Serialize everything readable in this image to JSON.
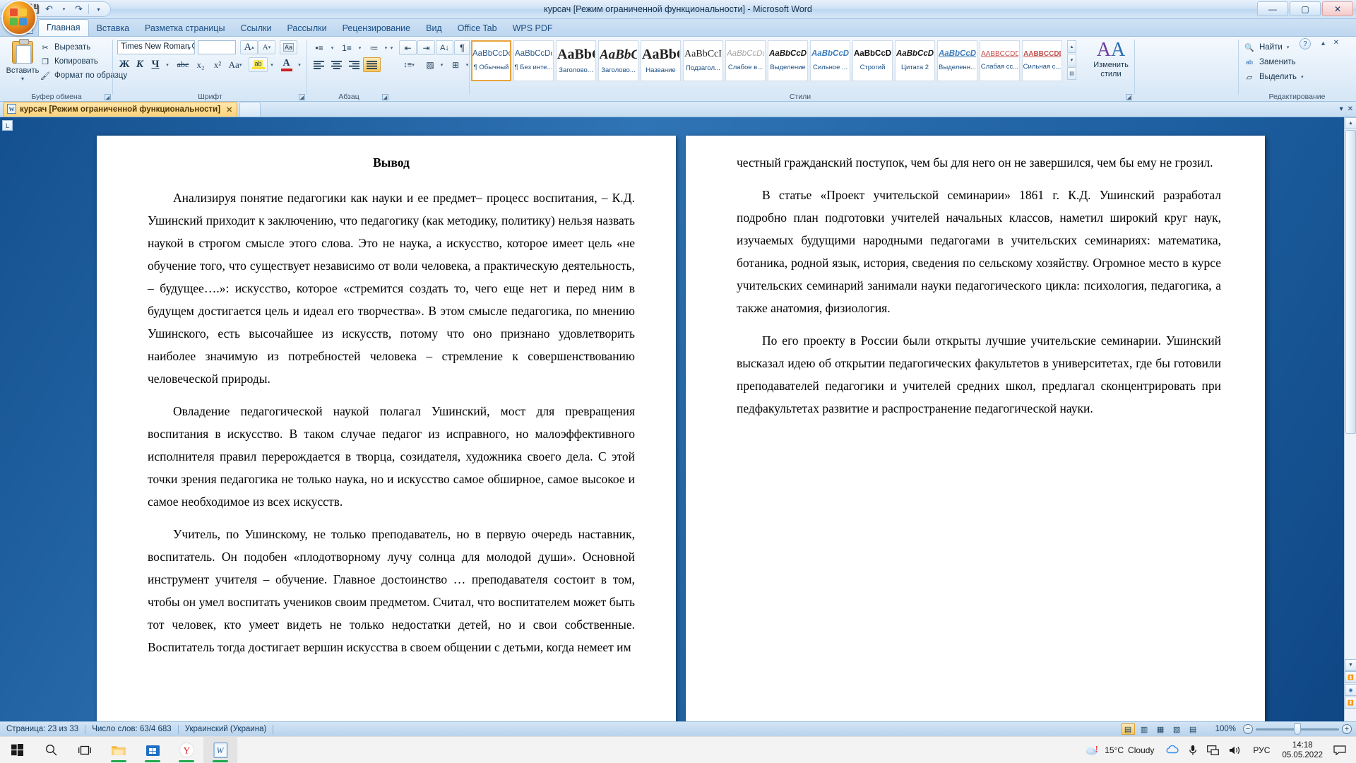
{
  "window": {
    "title": "курсач [Режим ограниченной функциональности] - Microsoft Word",
    "minimize": "—",
    "maximize": "▢",
    "close": "✕"
  },
  "quick_access": {
    "save": "💾",
    "undo": "↶",
    "undo_arrow": "▾",
    "redo": "↷",
    "customize": "▾"
  },
  "tabs": [
    {
      "label": "Главная",
      "active": true
    },
    {
      "label": "Вставка",
      "active": false
    },
    {
      "label": "Разметка страницы",
      "active": false
    },
    {
      "label": "Ссылки",
      "active": false
    },
    {
      "label": "Рассылки",
      "active": false
    },
    {
      "label": "Рецензирование",
      "active": false
    },
    {
      "label": "Вид",
      "active": false
    },
    {
      "label": "Office Tab",
      "active": false
    },
    {
      "label": "WPS PDF",
      "active": false
    }
  ],
  "ribbon": {
    "help_icon": "?",
    "collapse_icon": "▴",
    "close_icon": "✕",
    "groups": {
      "clipboard": {
        "label": "Буфер обмена",
        "paste": "Вставить",
        "paste_caret": "▾",
        "cut": "Вырезать",
        "cut_icon": "✂",
        "copy": "Копировать",
        "copy_icon": "❐",
        "format_painter": "Формат по образцу",
        "format_painter_icon": "🖌"
      },
      "font": {
        "label": "Шрифт",
        "font_name": "Times New Roman Cy",
        "font_size": "",
        "grow_font": "A",
        "shrink_font": "A",
        "clear_format": "Aa",
        "bold": "Ж",
        "italic": "К",
        "underline": "Ч",
        "strikethrough": "abc",
        "subscript": "x₂",
        "superscript": "x²",
        "change_case": "Aa",
        "highlight": "ab",
        "font_color": "A"
      },
      "paragraph": {
        "label": "Абзац",
        "bullets": "•≡",
        "numbering": "1≡",
        "multilevel": "≔",
        "align_left": "≡",
        "align_center": "≡",
        "align_right": "≡",
        "align_justify": "≡",
        "line_spacing": "↕≡",
        "shading": "▨",
        "borders": "⊞",
        "decrease_indent": "⇤",
        "increase_indent": "⇥",
        "sort": "A↓",
        "show_marks": "¶"
      },
      "styles": {
        "label": "Стили",
        "items": [
          {
            "sample": "AaBbCcDc",
            "name": "¶ Обычный",
            "selected": true,
            "style": "normal"
          },
          {
            "sample": "AaBbCcDc",
            "name": "¶ Без инте...",
            "selected": false,
            "style": "normal"
          },
          {
            "sample": "AaBbC",
            "name": "Заголово...",
            "selected": false,
            "style": "h1"
          },
          {
            "sample": "AaBbC",
            "name": "Заголово...",
            "selected": false,
            "style": "h2"
          },
          {
            "sample": "AaBbC",
            "name": "Название",
            "selected": false,
            "style": "h1"
          },
          {
            "sample": "AaBbCcI",
            "name": "Подзагол...",
            "selected": false,
            "style": "sub"
          },
          {
            "sample": "AaBbCcDc",
            "name": "Слабое в...",
            "selected": false,
            "style": "faint"
          },
          {
            "sample": "AaBbCcDc",
            "name": "Выделение",
            "selected": false,
            "style": "emph"
          },
          {
            "sample": "AaBbCcDc",
            "name": "Сильное ...",
            "selected": false,
            "style": "strongemph"
          },
          {
            "sample": "AaBbCcDc",
            "name": "Строгий",
            "selected": false,
            "style": "strong"
          },
          {
            "sample": "AaBbCcDc",
            "name": "Цитата 2",
            "selected": false,
            "style": "quote"
          },
          {
            "sample": "AaBbCcDc",
            "name": "Выделенн...",
            "selected": false,
            "style": "link"
          },
          {
            "sample": "AABBCCDD",
            "name": "Слабая сс...",
            "selected": false,
            "style": "weakref"
          },
          {
            "sample": "AABBCCDD",
            "name": "Сильная с...",
            "selected": false,
            "style": "strongref"
          }
        ],
        "nav_up": "▴",
        "nav_down": "▾",
        "nav_more": "▤",
        "change_styles": "Изменить стили",
        "change_styles_caret": "▾"
      },
      "editing": {
        "label": "Редактирование",
        "find": "Найти",
        "find_icon": "🔍",
        "find_caret": "▾",
        "replace": "Заменить",
        "replace_icon": "ab",
        "select": "Выделить",
        "select_icon": "▱",
        "select_caret": "▾"
      }
    }
  },
  "doc_tabs": {
    "active_tab": "курсач [Режим ограниченной функциональности]",
    "close": "✕",
    "nav_down": "▾",
    "nav_close": "✕"
  },
  "document": {
    "title": "Вывод",
    "left_page_paragraphs": [
      "Анализируя понятие педагогики как науки и ее предмет– процесс воспитания, – К.Д. Ушинский приходит к заключению, что педагогику  (как методику, политику) нельзя назвать наукой в строгом смысле этого слова. Это не наука, а искусство, которое имеет цель «не обучение того, что существует независимо от воли человека, а практическую деятельность, – будущее….»: искусство, которое «стремится создать то, чего еще нет и перед ним в будущем  достигается цель и идеал его творчества». В этом смысле педагогика, по мнению Ушинского, есть высочайшее из искусств, потому что оно признано удовлетворить наиболее значимую из потребностей человека – стремление к совершенствованию человеческой природы.",
      "Овладение педагогической наукой полагал Ушинский, мост для превращения воспитания в искусство. В таком случае педагог из исправного, но малоэффективного исполнителя правил перерождается в творца, созидателя, художника своего дела. С этой точки зрения педагогика не только наука, но и искусство самое обширное, самое высокое и самое необходимое из всех искусств.",
      "Учитель, по Ушинскому, не только преподаватель, но в первую очередь наставник, воспитатель. Он подобен «плодотворному лучу солнца для молодой души». Основной инструмент учителя –  обучение. Главное достоинство … преподавателя состоит в том, чтобы он умел воспитать учеников своим предметом. Считал, что воспитателем может быть тот человек, кто умеет видеть не только недостатки детей, но и свои собственные. Воспитатель тогда достигает вершин искусства в своем общении с детьми, когда немеет им"
    ],
    "right_page_paragraphs": [
      "честный гражданский поступок, чем бы для него он не завершился, чем бы ему не грозил.",
      "В статье «Проект учительской семинарии» 1861 г. К.Д. Ушинский разработал подробно план подготовки учителей начальных классов, наметил широкий круг наук, изучаемых будущими народными педагогами в учительских семинариях: математика, ботаника, родной язык, история, сведения по сельскому хозяйству. Огромное место в курсе учительских семинарий занимали науки педагогического цикла: психология, педагогика, а также анатомия, физиология.",
      "По его проекту в России были открыты лучшие учительские семинарии. Ушинский высказал идею об открытии педагогических факультетов в университетах, где бы готовили преподавателей педагогики и учителей средних школ, предлагал сконцентрировать при педфакультетах развитие и распространение педагогической науки."
    ]
  },
  "status_bar": {
    "page": "Страница: 23 из 33",
    "words": "Число слов: 63/4 683",
    "language": "Украинский (Украина)",
    "views": [
      "▤",
      "▥",
      "▦",
      "▧",
      "▤"
    ],
    "zoom_level": "100%",
    "zoom_out": "−",
    "zoom_in": "+"
  },
  "taskbar": {
    "start": "⊞",
    "search": "🔍",
    "task_view": "❐",
    "explorer": "📁",
    "store": "🛍",
    "yandex": "Y",
    "word": "W",
    "weather_temp": "15°C",
    "weather_desc": "Cloudy",
    "cloud_icon": "☁",
    "mic_icon": "🎤",
    "network_icon": "🖥",
    "volume_icon": "🔊",
    "language": "РУС",
    "time": "14:18",
    "date": "05.05.2022",
    "notifications": "▭"
  },
  "colors": {
    "accent": "#1a4f85",
    "selected_style": "#e8a33d",
    "desktop": "#1f5c9e"
  }
}
